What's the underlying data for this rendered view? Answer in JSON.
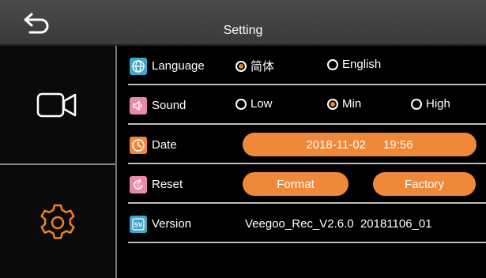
{
  "header": {
    "title": "Setting"
  },
  "rows": {
    "language": {
      "label": "Language",
      "options": [
        "简体",
        "English"
      ],
      "selected": "简体"
    },
    "sound": {
      "label": "Sound",
      "options": [
        "Low",
        "Min",
        "High"
      ],
      "selected": "Min"
    },
    "date": {
      "label": "Date",
      "date": "2018-11-02",
      "time": "19:56"
    },
    "reset": {
      "label": "Reset",
      "format_label": "Format",
      "factory_label": "Factory"
    },
    "version": {
      "label": "Version",
      "value": "Veegoo_Rec_V2.6.0  20181106_01"
    }
  },
  "colors": {
    "accent": "#f08020",
    "pill": "#f0883a",
    "icon_bg": "#3fa7c8",
    "icon_bg_pink": "#e88aa8",
    "icon_bg_orange": "#f0883a"
  },
  "icons": {
    "back": "back-arrow-icon",
    "video": "video-camera-icon",
    "settings": "gear-icon"
  }
}
